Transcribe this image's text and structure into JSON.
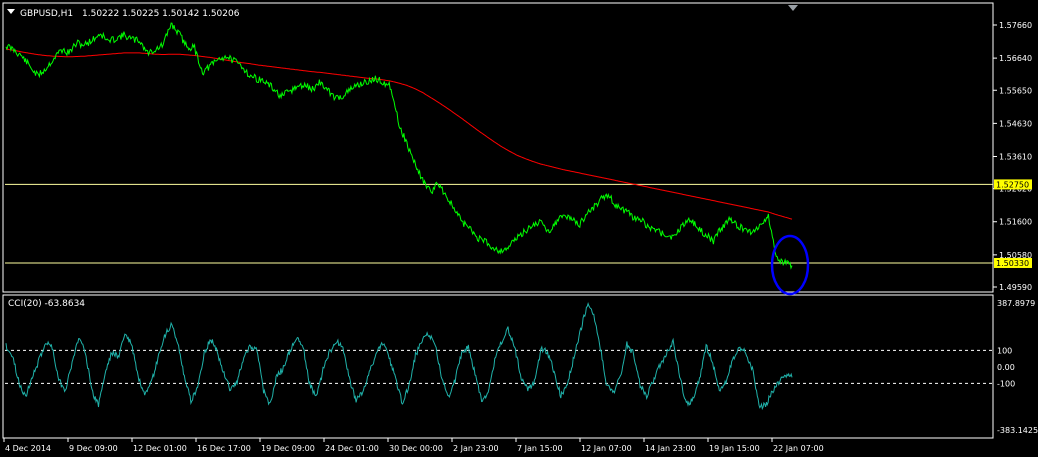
{
  "window": {
    "symbol_label": "GBPUSD,H1",
    "ohlc_label": "1.50222 1.50225 1.50142 1.50206",
    "indicator_label": "CCI(20) -63.8634"
  },
  "colors": {
    "background": "#000000",
    "grid": "#FFFFFF",
    "price_line": "#00FF00",
    "ma_line": "#FF0000",
    "cci_line": "#20B2AA",
    "hline": "#FFFFA0",
    "label_bg": "#FFFF00",
    "annotation": "#0000FF"
  },
  "chart_data": [
    {
      "type": "line",
      "x_labels": [
        "4 Dec 2014",
        "9 Dec 09:00",
        "12 Dec 01:00",
        "16 Dec 17:00",
        "19 Dec 09:00",
        "24 Dec 01:00",
        "30 Dec 00:00",
        "2 Jan 23:00",
        "7 Jan 15:00",
        "12 Jan 07:00",
        "14 Jan 23:00",
        "19 Jan 15:00",
        "22 Jan 07:00"
      ],
      "y_ticks": [
        "1.57660",
        "1.56640",
        "1.55650",
        "1.54630",
        "1.53610",
        "1.52620",
        "1.51600",
        "1.50580",
        "1.49590"
      ],
      "ylim": [
        1.4959,
        1.5766
      ],
      "series": [
        {
          "values": [
            1.5702,
            1.569,
            1.567,
            1.564,
            1.561,
            1.563,
            1.566,
            1.569,
            1.568,
            1.571,
            1.5705,
            1.572,
            1.574,
            1.5715,
            1.5725,
            1.5735,
            1.5722,
            1.5718,
            1.568,
            1.569,
            1.5705,
            1.577,
            1.574,
            1.57,
            1.5695,
            1.562,
            1.564,
            1.566,
            1.567,
            1.5655,
            1.564,
            1.561,
            1.56,
            1.559,
            1.557,
            1.5545,
            1.556,
            1.5575,
            1.558,
            1.5568,
            1.559,
            1.5562,
            1.554,
            1.555,
            1.557,
            1.5585,
            1.559,
            1.56,
            1.559,
            1.5575,
            1.546,
            1.54,
            1.534,
            1.529,
            1.525,
            1.528,
            1.524,
            1.52,
            1.516,
            1.514,
            1.511,
            1.51,
            1.508,
            1.507,
            1.5085,
            1.511,
            1.513,
            1.515,
            1.516,
            1.513,
            1.516,
            1.518,
            1.517,
            1.515,
            1.519,
            1.521,
            1.524,
            1.523,
            1.52,
            1.519,
            1.517,
            1.516,
            1.514,
            1.513,
            1.512,
            1.511,
            1.515,
            1.517,
            1.514,
            1.512,
            1.51,
            1.514,
            1.517,
            1.515,
            1.5135,
            1.513,
            1.515,
            1.518,
            1.505,
            1.5033,
            1.5025
          ]
        },
        {
          "values": [
            1.5692,
            1.5688,
            1.5683,
            1.5679,
            1.5675,
            1.5672,
            1.567,
            1.5669,
            1.5668,
            1.5669,
            1.567,
            1.5672,
            1.5674,
            1.5676,
            1.5678,
            1.568,
            1.568,
            1.568,
            1.5678,
            1.5676,
            1.5675,
            1.5676,
            1.5676,
            1.5674,
            1.5672,
            1.5669,
            1.5666,
            1.5662,
            1.5658,
            1.5654,
            1.565,
            1.5647,
            1.5643,
            1.564,
            1.5637,
            1.5634,
            1.5631,
            1.5628,
            1.5625,
            1.5622,
            1.562,
            1.5617,
            1.5614,
            1.5611,
            1.5608,
            1.5605,
            1.5602,
            1.56,
            1.5597,
            1.5593,
            1.5587,
            1.558,
            1.557,
            1.5558,
            1.5543,
            1.5528,
            1.5512,
            1.5495,
            1.5478,
            1.546,
            1.5442,
            1.5425,
            1.5408,
            1.5392,
            1.5378,
            1.5365,
            1.5355,
            1.5346,
            1.5338,
            1.5332,
            1.5326,
            1.532,
            1.5315,
            1.531,
            1.5305,
            1.53,
            1.5295,
            1.529,
            1.5285,
            1.528,
            1.5275,
            1.527,
            1.5265,
            1.526,
            1.5255,
            1.525,
            1.5245,
            1.524,
            1.5235,
            1.523,
            1.5225,
            1.522,
            1.5215,
            1.521,
            1.5205,
            1.52,
            1.5195,
            1.519,
            1.5182,
            1.5175,
            1.5168
          ]
        }
      ],
      "hlines": [
        {
          "value": 1.5275,
          "label": "1.52750"
        },
        {
          "value": 1.5033,
          "label": "1.50330"
        }
      ]
    },
    {
      "type": "line",
      "title": "CCI(20) -63.8634",
      "y_ticks": [
        "387.8979",
        "100",
        "0.00",
        "-100",
        "-383.1425"
      ],
      "ylim": [
        -383.1425,
        387.8979
      ],
      "reference_levels": [
        100,
        -100
      ],
      "series": [
        {
          "values": [
            130,
            60,
            -100,
            -180,
            -60,
            40,
            150,
            120,
            -80,
            -140,
            20,
            180,
            100,
            -150,
            -230,
            -40,
            90,
            60,
            200,
            140,
            -60,
            -180,
            -100,
            50,
            180,
            260,
            150,
            -60,
            -210,
            -120,
            80,
            170,
            90,
            -40,
            -140,
            -90,
            60,
            130,
            100,
            -150,
            -230,
            -50,
            -10,
            100,
            170,
            120,
            -110,
            -180,
            -20,
            90,
            160,
            120,
            -80,
            -200,
            -160,
            -40,
            80,
            150,
            60,
            -80,
            -220,
            -120,
            70,
            160,
            200,
            130,
            -70,
            -190,
            -80,
            90,
            120,
            -40,
            -200,
            -160,
            40,
            150,
            230,
            120,
            -60,
            -140,
            -90,
            110,
            90,
            -30,
            -180,
            -100,
            60,
            220,
            380,
            310,
            110,
            -120,
            -150,
            -60,
            140,
            80,
            -110,
            -180,
            -80,
            10,
            80,
            150,
            -60,
            -230,
            -200,
            -70,
            130,
            20,
            -140,
            -90,
            40,
            120,
            90,
            -10,
            -230,
            -240,
            -150,
            -90,
            -50,
            -64
          ]
        }
      ]
    }
  ]
}
